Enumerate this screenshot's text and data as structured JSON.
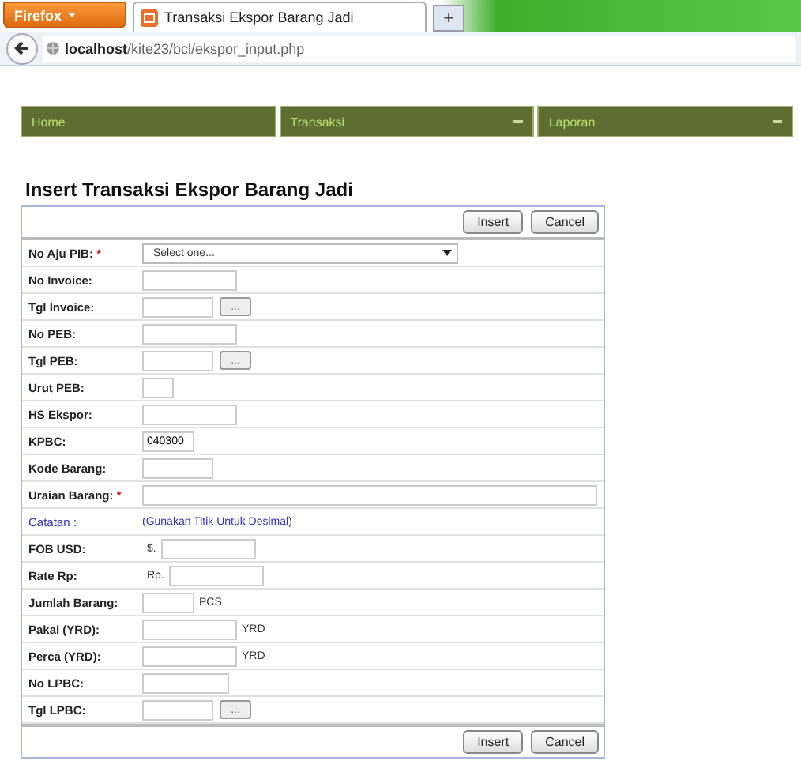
{
  "browser": {
    "menu_button": "Firefox",
    "tab_title": "Transaksi Ekspor Barang Jadi",
    "new_tab": "+",
    "url_host": "localhost",
    "url_path": "/kite23/bcl/ekspor_input.php"
  },
  "nav": [
    {
      "label": "Home",
      "dropdown": false
    },
    {
      "label": "Transaksi",
      "dropdown": true
    },
    {
      "label": "Laporan",
      "dropdown": true
    }
  ],
  "form": {
    "title": "Insert Transaksi Ekspor Barang Jadi",
    "buttons": [
      "Insert",
      "Cancel"
    ],
    "rows": [
      {
        "kind": "select",
        "label": "No Aju PIB:",
        "required_mark": "*",
        "value": "Select one..."
      },
      {
        "kind": "text",
        "label": "No Invoice:"
      },
      {
        "kind": "date",
        "label": "Tgl Invoice:",
        "button": "..."
      },
      {
        "kind": "text",
        "label": "No PEB:"
      },
      {
        "kind": "date",
        "label": "Tgl PEB:",
        "button": "..."
      },
      {
        "kind": "text",
        "label": "Urut PEB:"
      },
      {
        "kind": "text",
        "label": "HS Ekspor:"
      },
      {
        "kind": "text",
        "label": "KPBC:",
        "value": "040300"
      },
      {
        "kind": "text",
        "label": "Kode Barang:"
      },
      {
        "kind": "text",
        "label": "Uraian Barang:",
        "required_mark": "*"
      },
      {
        "kind": "note",
        "label": "Catatan :",
        "text": "(Gunakan Titik Untuk Desimal)"
      },
      {
        "kind": "text",
        "label": "FOB USD:",
        "prefix": "$."
      },
      {
        "kind": "text",
        "label": "Rate Rp:",
        "prefix": "Rp."
      },
      {
        "kind": "text",
        "label": "Jumlah Barang:",
        "suffix": "PCS"
      },
      {
        "kind": "text",
        "label": "Pakai (YRD):",
        "suffix": "YRD"
      },
      {
        "kind": "text",
        "label": "Perca (YRD):",
        "suffix": "YRD"
      },
      {
        "kind": "text",
        "label": "No LPBC:"
      },
      {
        "kind": "date",
        "label": "Tgl LPBC:",
        "button": "..."
      }
    ],
    "footer_buttons": [
      "Insert",
      "Cancel"
    ]
  }
}
